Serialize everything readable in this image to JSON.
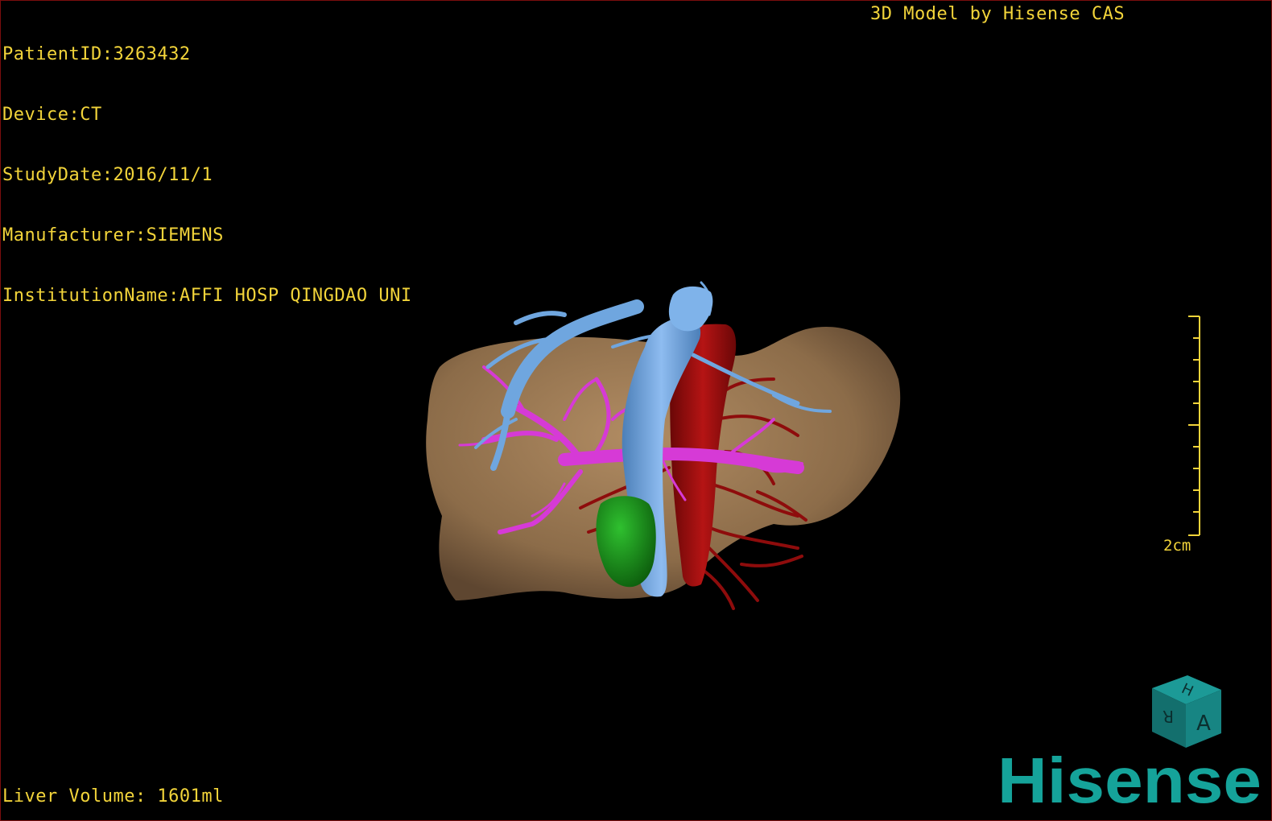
{
  "viewer": {
    "info_lines": [
      "PatientID:3263432",
      "Device:CT",
      "StudyDate:2016/11/1",
      "Manufacturer:SIEMENS",
      "InstitutionName:AFFI HOSP QINGDAO UNI"
    ],
    "brand_title": "3D Model by Hisense CAS",
    "liver_volume": "Liver Volume: 1601ml",
    "scale_label": "2cm",
    "logo_text": "Hisense",
    "cube_faces": [
      "H",
      "A",
      "R"
    ]
  },
  "colors": {
    "text": "#f2d43a",
    "liver": "#9b7a55",
    "hepatic_vein": "#6fa6df",
    "portal_vein": "#d63ad6",
    "artery": "#a10f0f",
    "tumor": "#1f8f1f",
    "logo": "#15a39a",
    "cube": "#157a78"
  }
}
